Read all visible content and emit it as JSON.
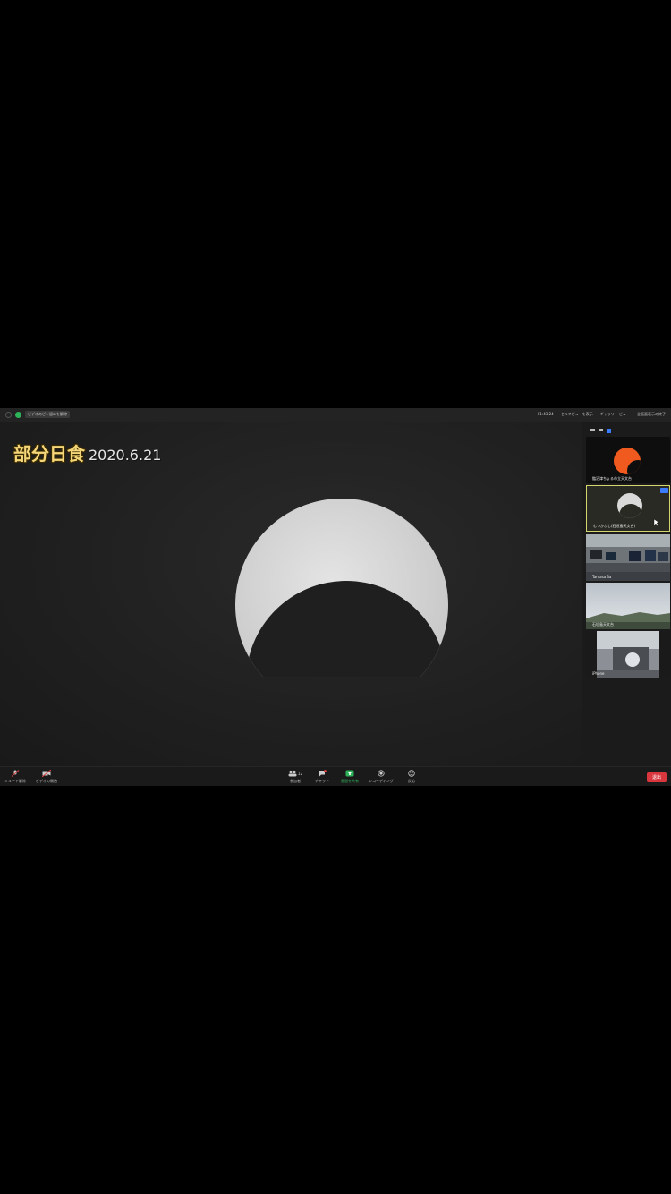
{
  "window": {
    "meeting_badge": "ビデオのピン留めを解除",
    "elapsed_time": "01:43:24",
    "self_view_toggle": "セルフビューを表示",
    "gallery_view": "ギャラリー ビュー",
    "fullscreen_exit": "全画面表示の終了"
  },
  "overlay": {
    "title_jp": "部分日食",
    "title_date": "2020.6.21"
  },
  "participants": [
    {
      "name": "臨沼津ちょる市立天文台"
    },
    {
      "name": "むつかぶし(石垣島天文台)"
    },
    {
      "name": "Tamasa 3a"
    },
    {
      "name": "石垣島天文台"
    },
    {
      "name": "iPhone"
    }
  ],
  "toolbar": {
    "mute": "ミュート解除",
    "video": "ビデオの開始",
    "participants": "参加者",
    "participants_count": "12",
    "chat": "チャット",
    "share": "画面を共有",
    "record": "レコーディング",
    "reactions": "反応",
    "end": "退出"
  },
  "colors": {
    "title_yellow": "#f5d77a",
    "share_green": "#2fb35a",
    "end_red": "#d9363e",
    "sun_gray": "#dcdcdc",
    "orange_sun": "#f05a1e"
  }
}
